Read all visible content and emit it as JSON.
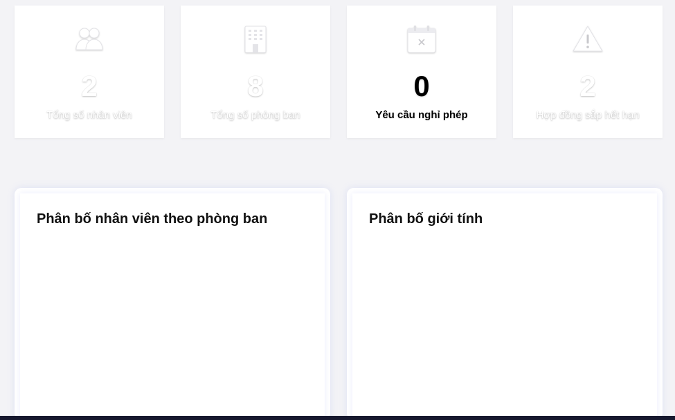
{
  "stats": [
    {
      "icon": "users-icon",
      "value": "2",
      "label": "Tổng số nhân viên"
    },
    {
      "icon": "building-icon",
      "value": "8",
      "label": "Tổng số phòng ban"
    },
    {
      "icon": "calendar-cancel-icon",
      "value": "0",
      "label": "Yêu cầu nghỉ phép"
    },
    {
      "icon": "warning-icon",
      "value": "2",
      "label": "Hợp đồng sắp hết hạn"
    }
  ],
  "panels": {
    "department": {
      "title": "Phân bố nhân viên theo phòng ban"
    },
    "gender": {
      "title": "Phân bố giới tính"
    }
  },
  "colors": {
    "background": "#f3f3f6",
    "card": "#ffffff",
    "bottom_bar": "#16182e"
  }
}
